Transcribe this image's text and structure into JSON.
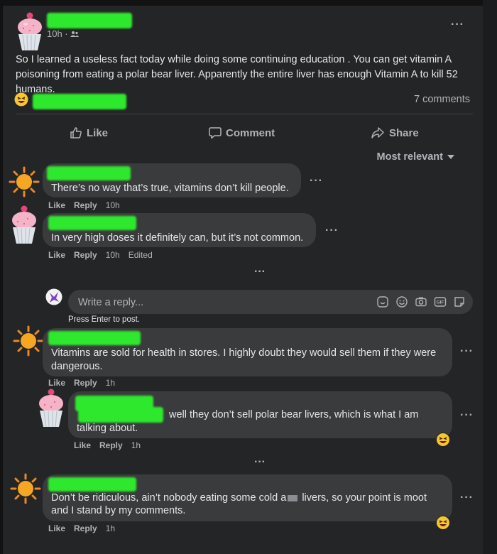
{
  "post": {
    "time": "10h ·",
    "text": "So I learned a useless fact today while doing some continuing education . You can get vitamin A poisoning from eating a polar bear liver. Apparently the entire liver has enough Vitamin A to kill 52 humans.",
    "comments_count": "7 comments",
    "more": "···"
  },
  "actions": {
    "like": "Like",
    "comment": "Comment",
    "share": "Share"
  },
  "sort": {
    "label": "Most relevant"
  },
  "comments": [
    {
      "text": "There’s no way that’s true, vitamins don’t kill people.",
      "like": "Like",
      "reply": "Reply",
      "time": "10h",
      "edited": ""
    },
    {
      "text": "In very high doses it definitely can, but it’s not common.",
      "like": "Like",
      "reply": "Reply",
      "time": "10h",
      "edited": "Edited"
    },
    {
      "text": "Vitamins are sold for health in stores. I highly doubt they would sell them if they were dangerous.",
      "like": "Like",
      "reply": "Reply",
      "time": "1h",
      "edited": ""
    },
    {
      "text_a": "well they don’t sell polar bear livers, which is what I am",
      "text_b": "talking about.",
      "like": "Like",
      "reply": "Reply",
      "time": "1h",
      "edited": ""
    },
    {
      "text_a": "Don’t be ridiculous, ain’t nobody eating some cold a",
      "text_b": "livers, so your point is moot",
      "text_c": "and I stand by my comments.",
      "like": "Like",
      "reply": "Reply",
      "time": "1h",
      "edited": ""
    }
  ],
  "reply_box": {
    "placeholder": "Write a reply...",
    "hint": "Press Enter to post."
  },
  "more_dots": "···",
  "colors": {
    "background": "#242526",
    "bubble": "#3a3b3c",
    "text": "#e4e6eb",
    "muted": "#b0b3b8",
    "redaction": "#2ee82e"
  },
  "icons": [
    "cupcake-avatar-icon",
    "sun-avatar-icon",
    "purple-avatar-icon",
    "friends-audience-icon",
    "laughing-emoji-icon",
    "like-thumb-icon",
    "comment-bubble-icon",
    "share-arrow-icon",
    "caret-down-icon",
    "sticker-icon",
    "smiley-icon",
    "camera-icon",
    "gif-icon",
    "avatar-sticker-icon"
  ]
}
